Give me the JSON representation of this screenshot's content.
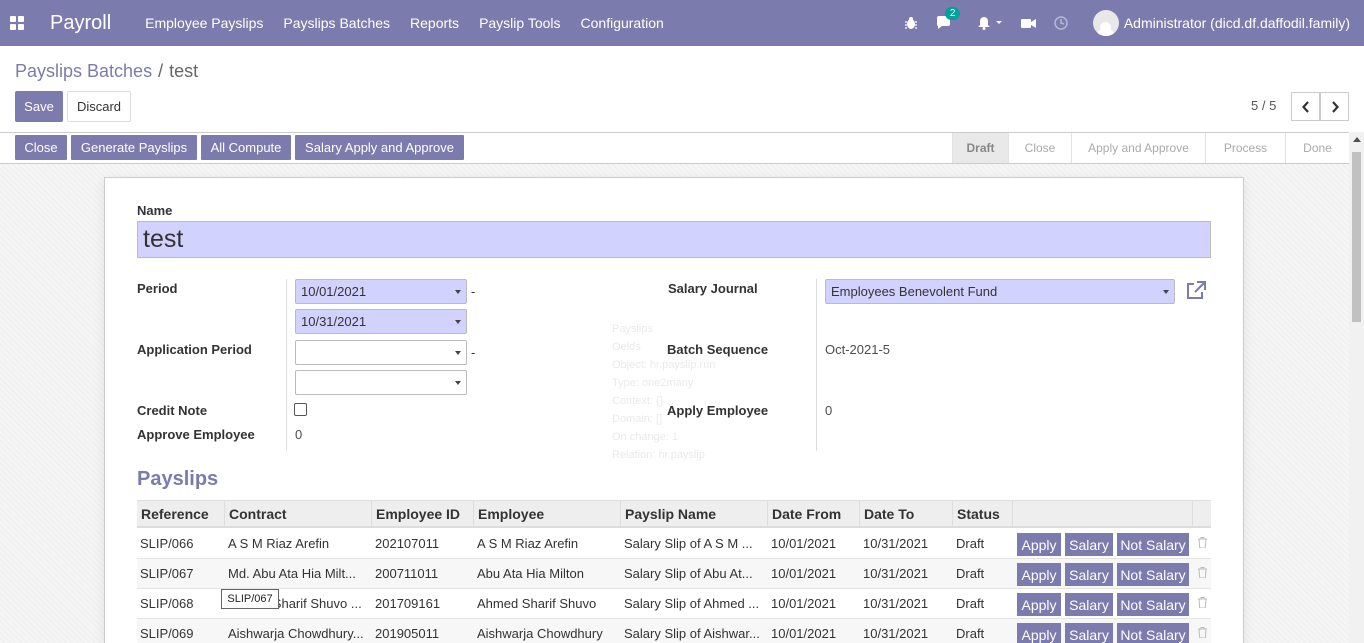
{
  "navbar": {
    "app_title": "Payroll",
    "menu": [
      "Employee Payslips",
      "Payslips Batches",
      "Reports",
      "Payslip Tools",
      "Configuration"
    ],
    "chat_count": "2",
    "user": "Administrator (dicd.df.daffodil.family)",
    "accent_color": "#7c7bad"
  },
  "breadcrumb": {
    "parent": "Payslips Batches",
    "separator": "/",
    "current": "test"
  },
  "buttons": {
    "save": "Save",
    "discard": "Discard"
  },
  "pager": {
    "value": "5 / 5"
  },
  "statusbar": {
    "actions": [
      "Close",
      "Generate Payslips",
      "All Compute",
      "Salary Apply and Approve"
    ],
    "stages": [
      "Draft",
      "Close",
      "Apply and Approve",
      "Process",
      "Done"
    ],
    "active_stage": "Draft"
  },
  "form": {
    "name_label": "Name",
    "name_value": "test",
    "period_label": "Period",
    "period_from": "10/01/2021",
    "period_to": "10/31/2021",
    "application_period_label": "Application Period",
    "application_from": "",
    "application_to": "",
    "credit_note_label": "Credit Note",
    "approve_employee_label": "Approve Employee",
    "approve_employee_value": "0",
    "salary_journal_label": "Salary Journal",
    "salary_journal_value": "Employees Benevolent Fund",
    "batch_sequence_label": "Batch Sequence",
    "batch_sequence_value": "Oct-2021-5",
    "apply_employee_label": "Apply Employee",
    "apply_employee_value": "0",
    "dash": "-"
  },
  "payslips": {
    "title": "Payslips",
    "columns": [
      "Reference",
      "Contract",
      "Employee ID",
      "Employee",
      "Payslip Name",
      "Date From",
      "Date To",
      "Status"
    ],
    "rows": [
      {
        "reference": "SLIP/066",
        "contract": "A S M Riaz Arefin",
        "employee_id": "202107011",
        "employee": "A S M Riaz Arefin",
        "payslip_name": "Salary Slip of A S M ...",
        "date_from": "10/01/2021",
        "date_to": "10/31/2021",
        "status": "Draft"
      },
      {
        "reference": "SLIP/067",
        "contract": "Md. Abu Ata Hia Milt...",
        "employee_id": "200711011",
        "employee": "Abu Ata Hia Milton",
        "payslip_name": "Salary Slip of Abu At...",
        "date_from": "10/01/2021",
        "date_to": "10/31/2021",
        "status": "Draft"
      },
      {
        "reference": "SLIP/068",
        "contract": "Ahmed Sharif Shuvo ...",
        "employee_id": "201709161",
        "employee": "Ahmed Sharif Shuvo",
        "payslip_name": "Salary Slip of Ahmed ...",
        "date_from": "10/01/2021",
        "date_to": "10/31/2021",
        "status": "Draft"
      },
      {
        "reference": "SLIP/069",
        "contract": "Aishwarja Chowdhury...",
        "employee_id": "201905011",
        "employee": "Aishwarja Chowdhury",
        "payslip_name": "Salary Slip of Aishwar...",
        "date_from": "10/01/2021",
        "date_to": "10/31/2021",
        "status": "Draft"
      }
    ],
    "row_actions": [
      "Apply",
      "Salary",
      "Not Salary"
    ],
    "tooltip": "SLIP/067"
  },
  "ghost_popup": {
    "lines": [
      "Payslips",
      "Oelds",
      "Object: hr.payslip.run",
      "Type: one2many",
      "Context: {}",
      "Domain: []",
      "On change: 1",
      "Relation: hr.payslip"
    ]
  }
}
